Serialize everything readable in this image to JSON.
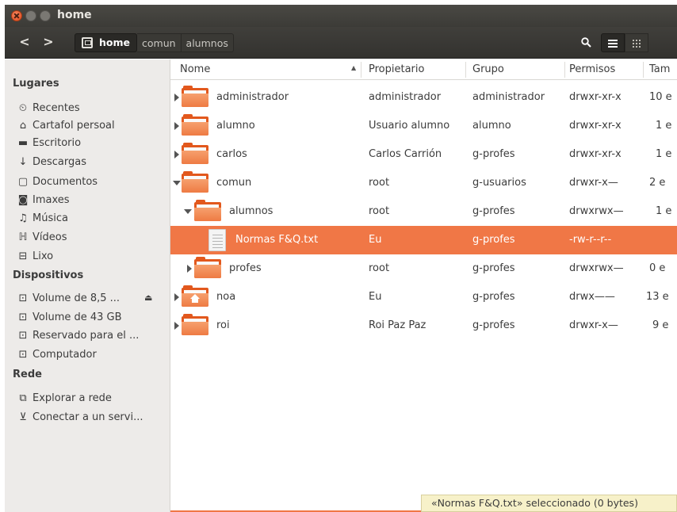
{
  "window": {
    "title": "home"
  },
  "toolbar": {
    "back_label": "<",
    "forward_label": ">",
    "breadcrumbs": [
      "home",
      "comun",
      "alumnos"
    ],
    "search_icon": "search-icon",
    "list_view_icon": "list-view-icon",
    "grid_view_icon": "grid-view-icon"
  },
  "sidebar": {
    "places": {
      "heading": "Lugares",
      "items": [
        {
          "label": "Recentes",
          "icon": "clock-icon"
        },
        {
          "label": "Cartafol persoal",
          "icon": "home-icon"
        },
        {
          "label": "Escritorio",
          "icon": "desktop-icon"
        },
        {
          "label": "Descargas",
          "icon": "download-icon"
        },
        {
          "label": "Documentos",
          "icon": "document-icon"
        },
        {
          "label": "Imaxes",
          "icon": "camera-icon"
        },
        {
          "label": "Música",
          "icon": "music-icon"
        },
        {
          "label": "Vídeos",
          "icon": "film-icon"
        },
        {
          "label": "Lixo",
          "icon": "trash-icon"
        }
      ]
    },
    "devices": {
      "heading": "Dispositivos",
      "items": [
        {
          "label": "Volume de 8,5 ...",
          "icon": "drive-icon"
        },
        {
          "label": "Volume de 43 GB",
          "icon": "drive-icon"
        },
        {
          "label": "Reservado para el ...",
          "icon": "drive-icon"
        },
        {
          "label": "Computador",
          "icon": "drive-icon"
        }
      ]
    },
    "network": {
      "heading": "Rede",
      "items": [
        {
          "label": "Explorar a rede",
          "icon": "network-icon"
        },
        {
          "label": "Conectar a un servi...",
          "icon": "server-icon"
        }
      ]
    }
  },
  "table": {
    "columns": [
      "Nome",
      "Propietario",
      "Grupo",
      "Permisos",
      "Tam"
    ],
    "rows": [
      {
        "name": "administrador",
        "owner": "administrador",
        "group": "administrador",
        "perms": "drwxr-xr-x",
        "size": "10 e"
      },
      {
        "name": "alumno",
        "owner": "Usuario alumno",
        "group": "alumno",
        "perms": "drwxr-xr-x",
        "size": "1 e"
      },
      {
        "name": "carlos",
        "owner": "Carlos Carrión",
        "group": "g-profes",
        "perms": "drwxr-xr-x",
        "size": "1 e"
      },
      {
        "name": "comun",
        "owner": "root",
        "group": "g-usuarios",
        "perms": "drwxr-x—",
        "size": "2 e"
      },
      {
        "name": "alumnos",
        "owner": "root",
        "group": "g-profes",
        "perms": "drwxrwx—",
        "size": "1 e"
      },
      {
        "name": "Normas F&Q.txt",
        "owner": "Eu",
        "group": "g-profes",
        "perms": "-rw-r--r--",
        "size": ""
      },
      {
        "name": "profes",
        "owner": "root",
        "group": "g-profes",
        "perms": "drwxrwx—",
        "size": "0 e"
      },
      {
        "name": "noa",
        "owner": "Eu",
        "group": "g-profes",
        "perms": "drwx——",
        "size": "13 e"
      },
      {
        "name": "roi",
        "owner": "Roi Paz Paz",
        "group": "g-profes",
        "perms": "drwxr-x—",
        "size": "9 e"
      }
    ]
  },
  "status": {
    "text": "«Normas F&Q.txt» seleccionado (0 bytes)"
  },
  "colors": {
    "accent": "#f07746",
    "titlebar": "#3c3b37",
    "sidebar": "#edebe9",
    "status_bg": "#f7f1c9"
  }
}
